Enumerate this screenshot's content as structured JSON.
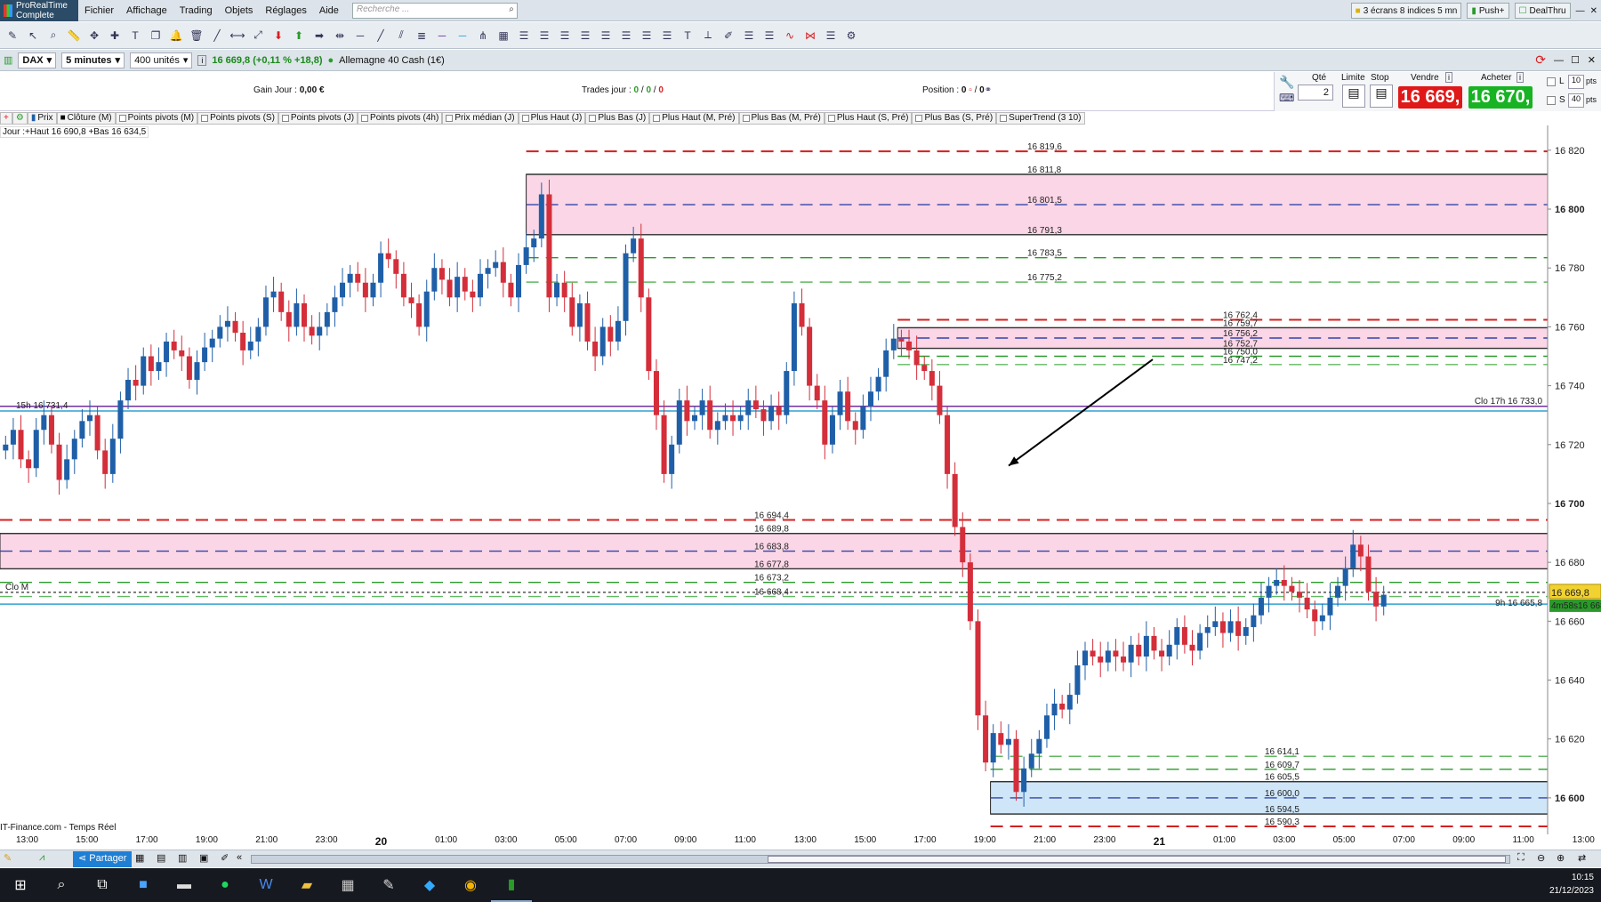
{
  "app": {
    "brand": "ProRealTime",
    "edition": "Complete"
  },
  "menu": [
    "Fichier",
    "Affichage",
    "Trading",
    "Objets",
    "Réglages",
    "Aide"
  ],
  "search": {
    "placeholder": "Recherche ..."
  },
  "menu_right": {
    "screens": "3 écrans 8 indices 5 mn",
    "push": "Push+",
    "dealthru": "DealThru"
  },
  "instrument": {
    "name": "DAX",
    "timeframe": "5 minutes",
    "units": "400 unités",
    "quote": "16 669,8 (+0,11 % +18,8)",
    "product": "Allemagne 40 Cash (1€)"
  },
  "trade": {
    "gain_label": "Gain Jour :",
    "gain_value": "0,00 €",
    "trades_label": "Trades jour :",
    "trades_g": "0",
    "trades_r": "0",
    "trades_t": "0",
    "position_label": "Position :",
    "position_value": "0",
    "position_extra": "0"
  },
  "order": {
    "qty_label": "Qté",
    "qty": "2",
    "limit_label": "Limite",
    "stop_label": "Stop",
    "sell_label": "Vendre",
    "sell_price": "16 669,",
    "buy_label": "Acheter",
    "buy_price": "16 670,",
    "l_label": "L",
    "l_val": "10",
    "s_label": "S",
    "s_val": "40",
    "pts": "pts"
  },
  "indicators": [
    "Prix",
    "Clôture (M)",
    "Points pivots (M)",
    "Points pivots (S)",
    "Points pivots (J)",
    "Points pivots (4h)",
    "Prix médian (J)",
    "Plus Haut (J)",
    "Plus Bas (J)",
    "Plus Haut (M, Pré)",
    "Plus Bas (M, Pré)",
    "Plus Haut (S, Pré)",
    "Plus Bas (S, Pré)",
    "SuperTrend (3 10)"
  ],
  "day_info": "Jour :+Haut 16 690,8 +Bas 16 634,5",
  "source": "IT-Finance.com - Temps Réel",
  "price_tag": "16 669,8",
  "countdown": "4m58s",
  "price_tag2": "16 668,8",
  "chart_data": {
    "type": "candlestick",
    "ylim": [
      16590,
      16826
    ],
    "y_ticks": [
      "16 600",
      "16 620",
      "16 640",
      "16 660",
      "16 680",
      "16 700",
      "16 720",
      "16 740",
      "16 760",
      "16 780",
      "16 800",
      "16 820"
    ],
    "y_ticks_bold": [
      "16 600",
      "16 700",
      "16 800"
    ],
    "x_ticks": [
      "13:00",
      "15:00",
      "17:00",
      "19:00",
      "21:00",
      "23:00",
      "20",
      "01:00",
      "03:00",
      "05:00",
      "07:00",
      "09:00",
      "11:00",
      "13:00",
      "15:00",
      "17:00",
      "19:00",
      "21:00",
      "23:00",
      "21",
      "01:00",
      "03:00",
      "05:00",
      "07:00",
      "09:00",
      "11:00",
      "13:00",
      "15:00"
    ],
    "x_ticks_bold": [
      "20",
      "21"
    ],
    "closes": [
      16720,
      16725,
      16715,
      16712,
      16725,
      16730,
      16720,
      16708,
      16715,
      16722,
      16728,
      16730,
      16718,
      16710,
      16722,
      16735,
      16742,
      16740,
      16750,
      16745,
      16748,
      16755,
      16752,
      16750,
      16742,
      16748,
      16753,
      16756,
      16760,
      16762,
      16758,
      16752,
      16755,
      16760,
      16770,
      16772,
      16765,
      16760,
      16768,
      16760,
      16757,
      16760,
      16765,
      16770,
      16775,
      16778,
      16775,
      16770,
      16775,
      16785,
      16783,
      16778,
      16770,
      16768,
      16760,
      16772,
      16780,
      16776,
      16770,
      16777,
      16772,
      16770,
      16778,
      16780,
      16782,
      16775,
      16770,
      16781,
      16787,
      16790,
      16805,
      16770,
      16775,
      16770,
      16760,
      16768,
      16755,
      16750,
      16760,
      16755,
      16762,
      16785,
      16790,
      16770,
      16745,
      16730,
      16710,
      16720,
      16735,
      16728,
      16730,
      16735,
      16725,
      16728,
      16730,
      16728,
      16730,
      16735,
      16732,
      16728,
      16733,
      16730,
      16745,
      16768,
      16760,
      16740,
      16735,
      16720,
      16730,
      16738,
      16728,
      16725,
      16733,
      16738,
      16743,
      16752,
      16756,
      16755,
      16752,
      16747,
      16745,
      16740,
      16730,
      16710,
      16692,
      16680,
      16660,
      16628,
      16612,
      16622,
      16618,
      16620,
      16602,
      16610,
      16615,
      16620,
      16628,
      16632,
      16630,
      16635,
      16645,
      16650,
      16648,
      16646,
      16650,
      16648,
      16646,
      16652,
      16648,
      16655,
      16650,
      16648,
      16652,
      16658,
      16652,
      16650,
      16656,
      16658,
      16660,
      16656,
      16660,
      16655,
      16658,
      16662,
      16668,
      16672,
      16674,
      16672,
      16670,
      16668,
      16664,
      16660,
      16662,
      16668,
      16672,
      16678,
      16686,
      16682,
      16670,
      16665,
      16669
    ],
    "series_colors": {
      "up": "#1f5fa8",
      "down": "#d42e3a"
    },
    "levels": [
      {
        "value": 16819.6,
        "label": "16 819,6",
        "color": "#d42020",
        "style": "dash",
        "x_start": 0.34
      },
      {
        "value": 16811.8,
        "label": "16 811,8",
        "color": "#333",
        "style": "solid",
        "x_start": 0.34
      },
      {
        "value": 16801.5,
        "label": "16 801,5",
        "color": "#3344aa",
        "style": "dash",
        "x_start": 0.34
      },
      {
        "value": 16791.3,
        "label": "16 791,3",
        "color": "#333",
        "style": "solid",
        "x_start": 0.34
      },
      {
        "value": 16783.5,
        "label": "16 783,5",
        "color": "#2a9a2a",
        "style": "dash",
        "x_start": 0.34
      },
      {
        "value": 16775.2,
        "label": "16 775,2",
        "color": "#62b862",
        "style": "dash",
        "x_start": 0.34
      },
      {
        "value": 16762.4,
        "label": "16 762,4",
        "color": "#d42020",
        "style": "dash",
        "x_start": 0.58
      },
      {
        "value": 16759.7,
        "label": "16 759,7",
        "color": "#333",
        "style": "solid",
        "x_start": 0.58
      },
      {
        "value": 16756.2,
        "label": "16 756,2",
        "color": "#3344aa",
        "style": "dash",
        "x_start": 0.58
      },
      {
        "value": 16752.7,
        "label": "16 752,7",
        "color": "#333",
        "style": "solid",
        "x_start": 0.58
      },
      {
        "value": 16750.0,
        "label": "16 750,0",
        "color": "#2a9a2a",
        "style": "dash",
        "x_start": 0.58
      },
      {
        "value": 16747.2,
        "label": "16 747,2",
        "color": "#62b862",
        "style": "dash",
        "x_start": 0.58
      },
      {
        "value": 16694.4,
        "label": "16 694,4",
        "color": "#d42020",
        "style": "dash",
        "x_start": 0.0
      },
      {
        "value": 16689.8,
        "label": "16 689,8",
        "color": "#333",
        "style": "solid",
        "x_start": 0.0
      },
      {
        "value": 16683.8,
        "label": "16 683,8",
        "color": "#3344aa",
        "style": "dash",
        "x_start": 0.0
      },
      {
        "value": 16677.8,
        "label": "16 677,8",
        "color": "#333",
        "style": "solid",
        "x_start": 0.0
      },
      {
        "value": 16673.2,
        "label": "16 673,2",
        "color": "#2a9a2a",
        "style": "dash",
        "x_start": 0.0
      },
      {
        "value": 16668.4,
        "label": "16 668,4",
        "color": "#62b862",
        "style": "dash",
        "x_start": 0.0
      },
      {
        "value": 16614.1,
        "label": "16 614,1",
        "color": "#62b862",
        "style": "dash",
        "x_start": 0.64
      },
      {
        "value": 16609.7,
        "label": "16 609,7",
        "color": "#2a9a2a",
        "style": "dash",
        "x_start": 0.64
      },
      {
        "value": 16605.5,
        "label": "16 605,5",
        "color": "#333",
        "style": "solid",
        "x_start": 0.64
      },
      {
        "value": 16600.0,
        "label": "16 600,0",
        "color": "#3344aa",
        "style": "dash",
        "x_start": 0.64
      },
      {
        "value": 16594.5,
        "label": "16 594,5",
        "color": "#333",
        "style": "solid",
        "x_start": 0.64
      },
      {
        "value": 16590.3,
        "label": "16 590,3",
        "color": "#d42020",
        "style": "dash",
        "x_start": 0.64
      }
    ],
    "zones": [
      {
        "from": 16791.3,
        "to": 16811.8,
        "color": "#fbd6e6",
        "x_start": 0.34
      },
      {
        "from": 16752.7,
        "to": 16759.7,
        "color": "#fbd6e6",
        "x_start": 0.58
      },
      {
        "from": 16677.8,
        "to": 16689.8,
        "color": "#fbd6e6",
        "x_start": 0.0
      },
      {
        "from": 16594.5,
        "to": 16605.5,
        "color": "#cfe6f8",
        "x_start": 0.64
      }
    ],
    "h_lines": [
      {
        "value": 16733.0,
        "label": "Clo 17h 16 733,0",
        "color": "#7030a0"
      },
      {
        "value": 16731.4,
        "label": "15h 16 731,4",
        "color": "#30a0d0"
      },
      {
        "value": 16665.8,
        "label": "9h 16 665,8",
        "color": "#30a0d0"
      },
      {
        "value": 16669.8,
        "label": "Clo M",
        "color": "#555"
      }
    ],
    "arrow": {
      "from": [
        0.72,
        0.33
      ],
      "to": [
        0.63,
        0.48
      ]
    }
  }
}
